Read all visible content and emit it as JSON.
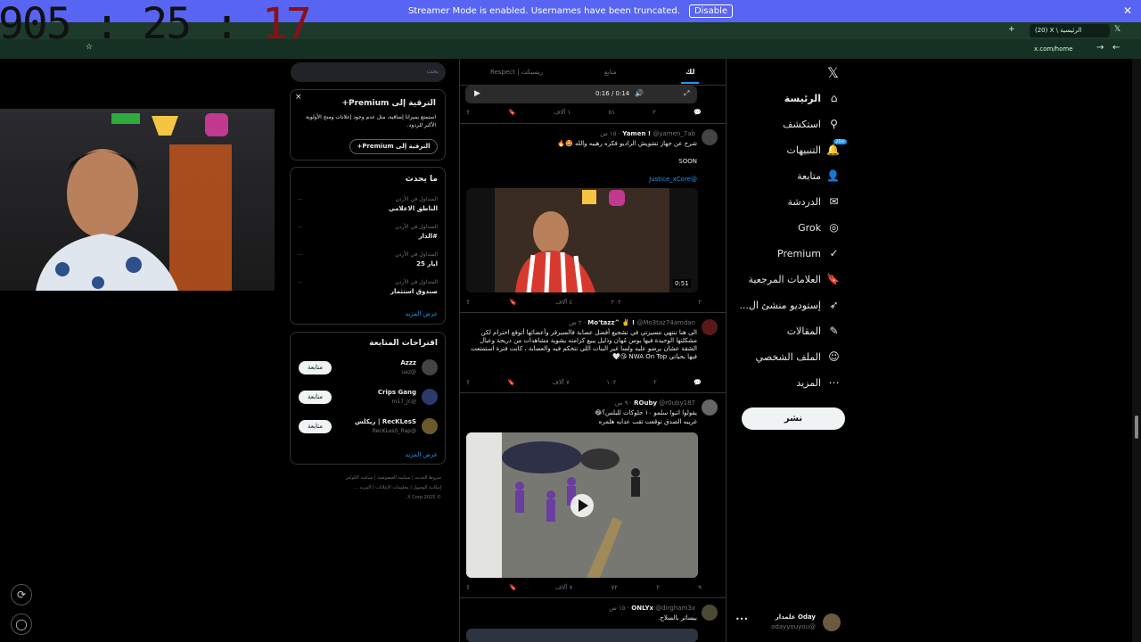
{
  "banner": {
    "text": "Streamer Mode is enabled. Usernames have been truncated.",
    "button": "Disable",
    "close": "✕"
  },
  "overlay": {
    "clock_a": "905 : 25 : ",
    "clock_b": "17"
  },
  "browser": {
    "tab_title": "(20) X \\ الرئيسية",
    "url": "x.com/home"
  },
  "sidebar": {
    "items": [
      {
        "label": "الرئيسة",
        "icon": "home-icon"
      },
      {
        "label": "استكشف",
        "icon": "search-icon"
      },
      {
        "label": "التنبيهات",
        "icon": "bell-icon",
        "badge": "+20"
      },
      {
        "label": "متابعة",
        "icon": "follow-icon"
      },
      {
        "label": "الدردشة",
        "icon": "chat-icon"
      },
      {
        "label": "Grok",
        "icon": "grok-icon"
      },
      {
        "label": "Premium",
        "icon": "premium-icon"
      },
      {
        "label": "العلامات المرجعية",
        "icon": "bookmark-icon"
      },
      {
        "label": "إستوديو منشئ ال...",
        "icon": "rocket-icon"
      },
      {
        "label": "المقالات",
        "icon": "article-icon"
      },
      {
        "label": "الملف الشخصي",
        "icon": "profile-icon"
      },
      {
        "label": "المزيد",
        "icon": "more-icon"
      }
    ],
    "post": "نشر",
    "account": {
      "name": "Oday علمدار",
      "handle": "@odayyouyou"
    }
  },
  "feed": {
    "tabs": [
      "لك",
      "متابع",
      "Respect | ريسبكت"
    ],
    "video_time": "0:16 / 0:14",
    "tweets": [
      {
        "name": "Yamen !",
        "handle": "@yamen_7ab",
        "time": "١٥ س",
        "text1": "شرح عن جهاز تشويش الراديو فكره رهيبه والله 🤩🔥",
        "text2": "SOON",
        "mention": "@Justice_xCore",
        "duration": "0:51",
        "replies": "٢",
        "reposts": "",
        "likes": "٢٠٢",
        "views": "٤ آلاف"
      },
      {
        "name": "Mo'tazz^ ✌️ !",
        "handle": "@Mo3taz74amdan",
        "time": "٢ س",
        "text": "الى هنا تنتهي مسيرتي في تشجيع أفضل عصابة فالسيرفر وأعضائها أتوقع احترام لكن مشكلتها الوحيدة فيها بوس مُهان وذليل يبيع كرامته بشوية مشاهدات من دريحة وعيال الشقة عشان يرضو عليه ولسا غير البنات اللي تتحكم فيه والعصابة ، كانت فترة استمتعت فيها بحياتي NWA On Top 😘🤍",
        "replies": "",
        "reposts": "٢",
        "likes": "١٠٢",
        "views": "٧ آلاف"
      },
      {
        "name": "ROuby",
        "handle": "@r0uby187",
        "time": "٩ س",
        "text1": "يقولوا اتبوا سلمو ١٠ حلوكات للبلس؟😂",
        "text2": "غريبه الصدق توقعت تقب عدايه هلمره",
        "replies": "٩",
        "reposts": "٢",
        "likes": "٧٢",
        "views": "٧ آلاف"
      },
      {
        "name": "ONLYx",
        "handle": "@dirgham3x",
        "time": "١٥ س",
        "text1": "بيساتر بالسلاح."
      }
    ],
    "first_acts": {
      "replies": "",
      "reposts": "٢",
      "likes": "٥١",
      "views": "١ آلاف"
    }
  },
  "right": {
    "search_placeholder": "بحث",
    "premium": {
      "title": "الترقية إلى Premium+",
      "body": "استمتع بميزانا إضافية، مثل عدم وجود إعلانات ومنح الأولوية الأكبر للردود.",
      "button": "الترقية إلى Premium+"
    },
    "trends": {
      "title": "ما يحدث",
      "items": [
        {
          "cat": "المتداول في الأردن",
          "name": "الناطق الاعلامي"
        },
        {
          "cat": "المتداول في الأردن",
          "name": "#الدار"
        },
        {
          "cat": "المتداول في الأردن",
          "name": "ايار 25"
        },
        {
          "cat": "المتداول في الأردن",
          "name": "صندوق استثمار"
        }
      ],
      "more": "عرض المزيد"
    },
    "follow": {
      "title": "اقتراحات المتابعة",
      "items": [
        {
          "name": "Azzz",
          "handle": "@uaz",
          "btn": "متابعة"
        },
        {
          "name": "Crips Gang",
          "handle": "@m17_jc",
          "btn": "متابعة"
        },
        {
          "name": "RecKLesS | ريكلس",
          "handle": "@RecKLesS_Rap",
          "btn": "متابعة"
        }
      ],
      "more": "عرض المزيد"
    },
    "footer": [
      "شروط الخدمة",
      "سياسة الخصوصية",
      "سياسة الكوكيز",
      "إمكانية الوصول",
      "معلومات الإعلانات",
      "المزيد ...",
      "© 2025 X Corp."
    ]
  }
}
